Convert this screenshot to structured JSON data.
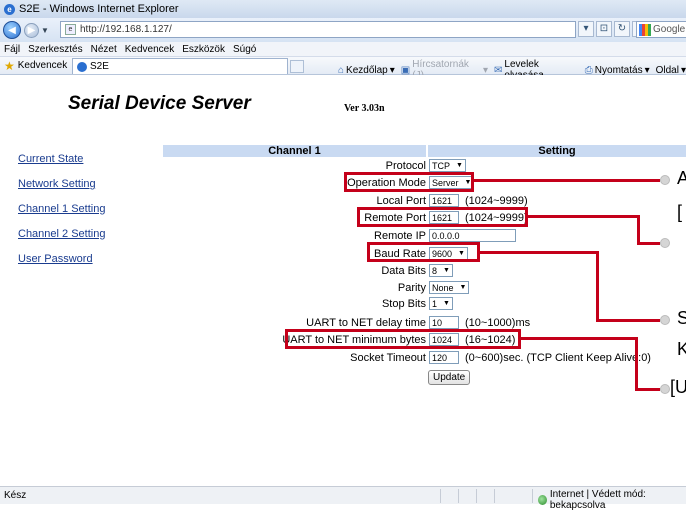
{
  "window": {
    "title": "S2E - Windows Internet Explorer"
  },
  "address": {
    "url": "http://192.168.1.127/",
    "search_placeholder": "Google"
  },
  "menu": [
    "Fájl",
    "Szerkesztés",
    "Nézet",
    "Kedvencek",
    "Eszközök",
    "Súgó"
  ],
  "favbar": {
    "favorites_label": "Kedvencek",
    "tab_title": "S2E",
    "home": "Kezdőlap",
    "feeds": "Hírcsatornák (J)",
    "mail": "Levelek olvasása",
    "print": "Nyomtatás",
    "page": "Oldal"
  },
  "page": {
    "brand": "Serial Device Server",
    "version": "Ver 3.03n",
    "nav": [
      "Current State",
      "Network Setting",
      "Channel 1 Setting",
      "Channel 2 Setting",
      "User Password"
    ],
    "header_channel": "Channel 1",
    "header_setting": "Setting",
    "fields": {
      "protocol": {
        "label": "Protocol",
        "value": "TCP"
      },
      "operation_mode": {
        "label": "Operation Mode",
        "value": "Server"
      },
      "local_port": {
        "label": "Local Port",
        "value": "1621",
        "hint": "(1024~9999)"
      },
      "remote_port": {
        "label": "Remote Port",
        "value": "1621",
        "hint": "(1024~9999)"
      },
      "remote_ip": {
        "label": "Remote IP",
        "value": "0.0.0.0"
      },
      "baud_rate": {
        "label": "Baud Rate",
        "value": "9600"
      },
      "data_bits": {
        "label": "Data Bits",
        "value": "8"
      },
      "parity": {
        "label": "Parity",
        "value": "None"
      },
      "stop_bits": {
        "label": "Stop Bits",
        "value": "1"
      },
      "uart_delay": {
        "label": "UART to NET delay time",
        "value": "10",
        "hint": "(10~1000)ms"
      },
      "uart_min": {
        "label": "UART to NET minimum bytes",
        "value": "1024",
        "hint": "(16~1024)"
      },
      "socket_timeout": {
        "label": "Socket Timeout",
        "value": "120",
        "hint": "(0~600)sec. (TCP Client Keep Alive:0)"
      }
    },
    "update_button": "Update",
    "callouts": [
      "A",
      "[",
      "S",
      "K",
      "[U"
    ]
  },
  "status": {
    "left": "Kész",
    "zone": "Internet | Védett mód: bekapcsolva"
  },
  "colors": {
    "annotation_red": "#c4001a",
    "header_blue": "#c9daf2",
    "link_blue": "#1a3c8f"
  }
}
